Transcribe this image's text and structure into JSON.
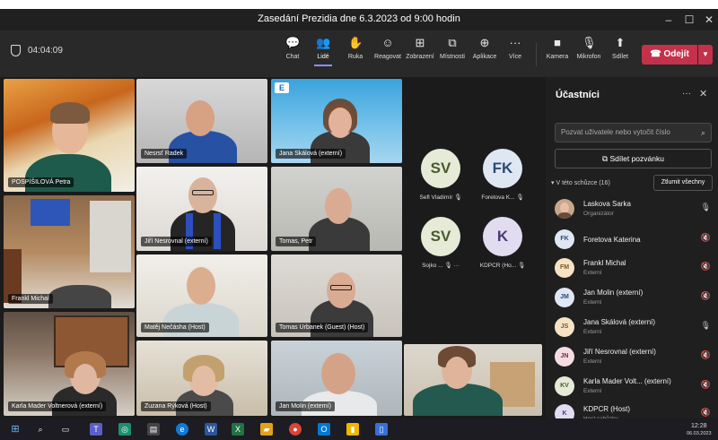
{
  "window": {
    "title": "Zasedání Prezidia dne 6.3.2023 od 9:00 hodin",
    "minimize": "–",
    "maximize": "☐",
    "close": "✕"
  },
  "toolbar": {
    "timer": "04:04:09",
    "buttons": [
      {
        "label": "Chat",
        "icon": "chat-icon"
      },
      {
        "label": "Lidé",
        "icon": "people-icon"
      },
      {
        "label": "Ruka",
        "icon": "hand-icon"
      },
      {
        "label": "Reagovat",
        "icon": "emoji-icon"
      },
      {
        "label": "Zobrazení",
        "icon": "view-icon"
      },
      {
        "label": "Místnosti",
        "icon": "rooms-icon"
      },
      {
        "label": "Aplikace",
        "icon": "apps-icon"
      },
      {
        "label": "Více",
        "icon": "more-icon"
      },
      {
        "label": "Kamera",
        "icon": "camera-icon"
      },
      {
        "label": "Mikrofon",
        "icon": "mic-icon"
      },
      {
        "label": "Sdílet",
        "icon": "share-icon"
      }
    ],
    "leave_label": "Odejít",
    "leave_color": "#c4314b",
    "active_tab": "Lidé"
  },
  "tiles": [
    {
      "name": "POSPÍŠILOVÁ Petra"
    },
    {
      "name": "Nesrsť Radek"
    },
    {
      "name": "Jana Skálová (externí)",
      "logo_text": "E"
    },
    {
      "name": "Jiří Nesrovnal (externí)"
    },
    {
      "name": "Tomas, Petr"
    },
    {
      "name": "Frankl Michal"
    },
    {
      "name": "Matěj Nečásha (Host)"
    },
    {
      "name": "Tomas Urbanek (Guest) (Host)"
    },
    {
      "name": "Karla Mader Voltnerová (externí)"
    },
    {
      "name": "Zuzana Rýková (Host)"
    },
    {
      "name": "Jan Molin (externí)"
    },
    {
      "name": ""
    }
  ],
  "avatar_tiles": [
    {
      "initials": "SV",
      "name": "Sefl Vladimír",
      "bg": "#e6ebd8",
      "fg": "#4a5a2a"
    },
    {
      "initials": "FK",
      "name": "Foretova K...",
      "bg": "#dfe7f3",
      "fg": "#2a4a7a"
    },
    {
      "initials": "SV",
      "name": "Sojko ...",
      "bg": "#e6ebd8",
      "fg": "#4a5a2a"
    },
    {
      "initials": "K",
      "name": "KDPCR (Ho...",
      "bg": "#e2dcf0",
      "fg": "#4a3a7a"
    }
  ],
  "panel": {
    "title": "Účastníci",
    "more": "···",
    "close": "✕",
    "invite_placeholder": "Pozvat uživatele nebo vytočit číslo",
    "share_invite": "Sdílet pozvánku",
    "section": "V této schůzce (16)",
    "mute_all": "Ztlumit všechny",
    "participants": [
      {
        "name": "Laskova Sarka",
        "role": "Organizátor",
        "initials": "",
        "bg": "#c9a58a",
        "fg": "#3a2a1a",
        "mic": "on"
      },
      {
        "name": "Foretova Katerina",
        "role": "",
        "initials": "FK",
        "bg": "#dfe7f3",
        "fg": "#2a4a7a",
        "mic": "off"
      },
      {
        "name": "Frankl Michal",
        "role": "Externí",
        "initials": "FM",
        "bg": "#f6e3c6",
        "fg": "#7a5a1a",
        "mic": "off"
      },
      {
        "name": "Jan Molin (externí)",
        "role": "Externí",
        "initials": "JM",
        "bg": "#dfe7f3",
        "fg": "#2a4a7a",
        "mic": "off"
      },
      {
        "name": "Jana Skálová (externí)",
        "role": "Externí",
        "initials": "JS",
        "bg": "#f6e3c6",
        "fg": "#7a5a1a",
        "mic": "on"
      },
      {
        "name": "Jiří Nesrovnal (externí)",
        "role": "Externí",
        "initials": "JN",
        "bg": "#f3dde3",
        "fg": "#7a2a3a",
        "mic": "off"
      },
      {
        "name": "Karla Mader Volt... (externí)",
        "role": "Externí",
        "initials": "KV",
        "bg": "#e6ebd8",
        "fg": "#4a5a2a",
        "mic": "off"
      },
      {
        "name": "KDPCR (Host)",
        "role": "Host schůzky",
        "initials": "K",
        "bg": "#e2dcf0",
        "fg": "#4a3a7a",
        "mic": "off"
      }
    ]
  },
  "taskbar": {
    "time": "12:28",
    "date": "06.03.2023"
  }
}
